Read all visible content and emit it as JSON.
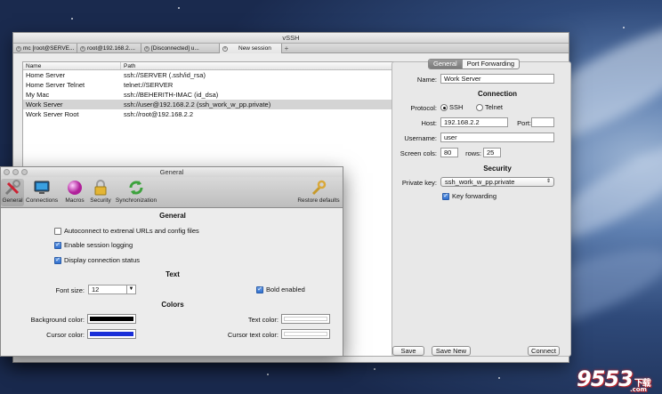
{
  "main_window": {
    "title": "vSSH",
    "tabs": [
      "mc [root@SERVE...",
      "root@192.168.2....",
      "[Disconnected] u...",
      "New session"
    ],
    "add_tab_symbol": "+",
    "columns": [
      "Name",
      "Path"
    ],
    "rows": [
      {
        "name": "Home Server",
        "path": "ssh://SERVER (.ssh/id_rsa)"
      },
      {
        "name": "Home Server Telnet",
        "path": "telnet://SERVER"
      },
      {
        "name": "My Mac",
        "path": "ssh://BEHERITH-IMAC (id_dsa)"
      },
      {
        "name": "Work Server",
        "path": "ssh://user@192.168.2.2 (ssh_work_w_pp.private)",
        "selected": true
      },
      {
        "name": "Work Server Root",
        "path": "ssh://root@192.168.2.2"
      }
    ]
  },
  "session_panel": {
    "tabs": [
      "General",
      "Port Forwarding"
    ],
    "active_tab": "General",
    "name_label": "Name:",
    "name_value": "Work Server",
    "connection_header": "Connection",
    "protocol_label": "Protocol:",
    "protocol_options": [
      "SSH",
      "Telnet"
    ],
    "protocol_selected": "SSH",
    "host_label": "Host:",
    "host_value": "192.168.2.2",
    "port_label": "Port:",
    "port_value": "",
    "username_label": "Username:",
    "username_value": "user",
    "screen_cols_label": "Screen cols:",
    "cols_value": "80",
    "rows_label": "rows:",
    "rows_value": "25",
    "security_header": "Security",
    "private_key_label": "Private key:",
    "private_key_value": "ssh_work_w_pp.private",
    "key_forwarding_label": "Key forwarding",
    "key_forwarding_checked": true,
    "save_label": "Save",
    "save_new_label": "Save New",
    "connect_label": "Connect"
  },
  "prefs_dialog": {
    "title": "General",
    "toolbar": [
      {
        "label": "General",
        "icon": "tools-icon",
        "selected": true
      },
      {
        "label": "Connections",
        "icon": "monitor-icon"
      },
      {
        "label": "Macros",
        "icon": "macro-ball-icon"
      },
      {
        "label": "Security",
        "icon": "lock-icon"
      },
      {
        "label": "Synchronization",
        "icon": "sync-icon"
      }
    ],
    "restore_defaults_label": "Restore defaults",
    "general_header": "General",
    "autoconnect_label": "Autoconnect to extrenal URLs and config files",
    "autoconnect_checked": false,
    "session_logging_label": "Enable session logging",
    "session_logging_checked": true,
    "display_status_label": "Display connection status",
    "display_status_checked": true,
    "text_header": "Text",
    "font_size_label": "Font size:",
    "font_size_value": "12",
    "bold_label": "Bold enabled",
    "bold_checked": true,
    "colors_header": "Colors",
    "background_color_label": "Background color:",
    "background_color": "#000000",
    "text_color_label": "Text color:",
    "text_color": "#ffffff",
    "cursor_color_label": "Cursor color:",
    "cursor_color": "#1a2fd8",
    "cursor_text_color_label": "Cursor text color:",
    "cursor_text_color": "#ffffff"
  },
  "watermark": {
    "text": "9553",
    "suffix": "下载",
    "sub": ".com"
  }
}
